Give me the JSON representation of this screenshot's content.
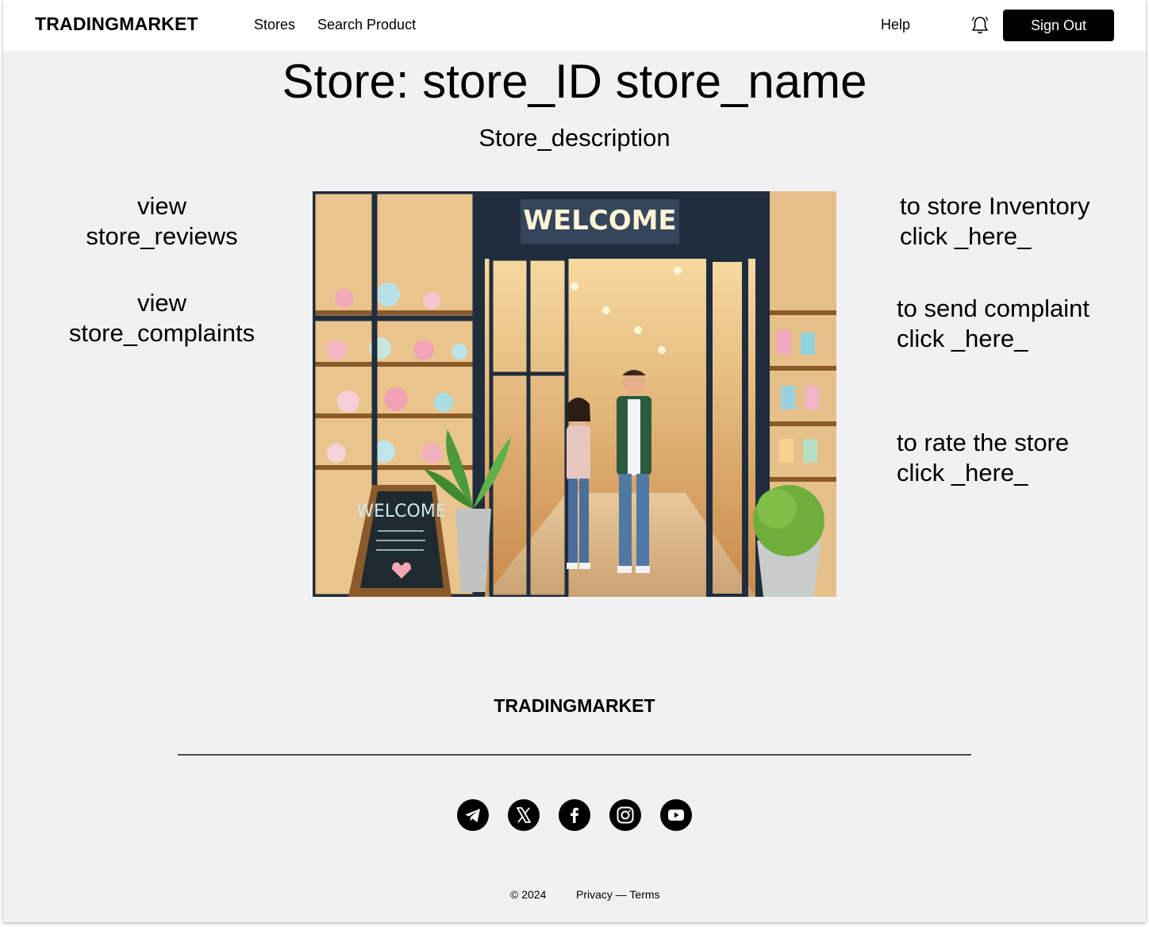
{
  "header": {
    "logo": "TRADINGMARKET",
    "nav": {
      "stores": "Stores",
      "search_product": "Search Product",
      "help": "Help"
    },
    "notification_icon": "bell-icon",
    "sign_out": "Sign Out"
  },
  "main": {
    "title": "Store: store_ID store_name",
    "description": "Store_description",
    "left_links": {
      "reviews": {
        "line1": "view",
        "line2": "store_reviews"
      },
      "complaints": {
        "line1": "view",
        "line2": "store_complaints"
      }
    },
    "right_links": {
      "inventory": {
        "line1": "to store Inventory",
        "line2": "click _here_"
      },
      "complaint": {
        "line1": "to send complaint",
        "line2": "click _here_"
      },
      "rate": {
        "line1": "to rate the store",
        "line2": "click _here_"
      }
    },
    "image": {
      "sign_text": "WELCOME",
      "board_text": "WELCOME"
    }
  },
  "footer": {
    "logo": "TRADINGMARKET",
    "social_icons": [
      "telegram-icon",
      "x-icon",
      "facebook-icon",
      "instagram-icon",
      "youtube-icon"
    ],
    "copyright": "© 2024",
    "legal": "Privacy — Terms"
  },
  "colors": {
    "button_bg": "#000000",
    "page_bg": "#f1f1f1",
    "header_bg": "#ffffff"
  }
}
